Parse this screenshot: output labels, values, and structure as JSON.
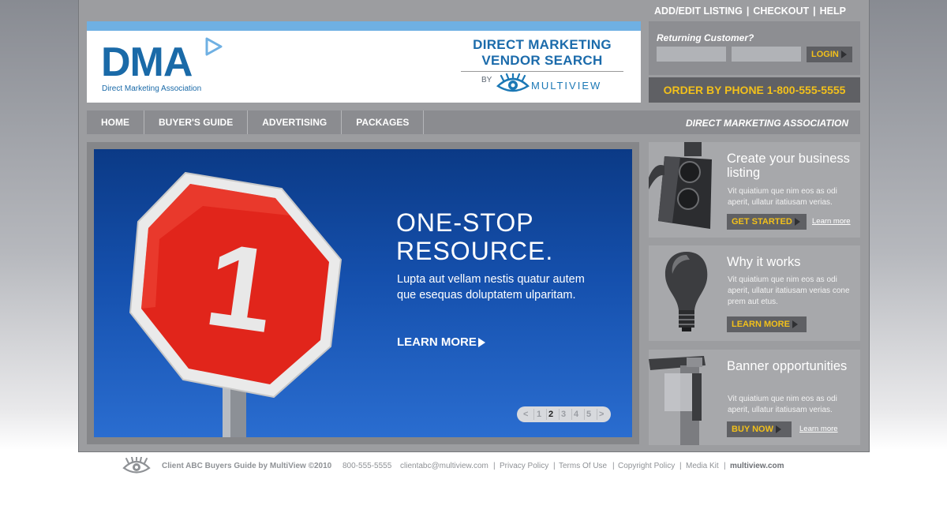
{
  "top_links": {
    "add_edit": "ADD/EDIT LISTING",
    "checkout": "CHECKOUT",
    "help": "HELP",
    "sep": "|"
  },
  "logo": {
    "mark": "DMA",
    "subtitle": "Direct Marketing Association",
    "title_line1": "DIRECT MARKETING",
    "title_line2": "VENDOR SEARCH",
    "by": "BY",
    "partner": "MULTIVIEW"
  },
  "login": {
    "heading": "Returning Customer?",
    "button": "LOGIN",
    "username_value": "",
    "password_value": ""
  },
  "order_by_phone": "ORDER BY PHONE 1-800-555-5555",
  "nav": {
    "items": [
      "HOME",
      "BUYER'S GUIDE",
      "ADVERTISING",
      "PACKAGES"
    ],
    "tagline": "DIRECT MARKETING ASSOCIATION"
  },
  "hero": {
    "sign_number": "1",
    "title_line1": "ONE-STOP",
    "title_line2": "RESOURCE.",
    "body": "Lupta aut vellam nestis quatur autem que esequas doluptatem ulparitam.",
    "cta": "LEARN MORE",
    "pager": {
      "prev": "<",
      "pages": [
        "1",
        "2",
        "3",
        "4",
        "5"
      ],
      "active": "2",
      "next": ">"
    }
  },
  "promos": [
    {
      "title": "Create your business listing",
      "body": "Vit quiatium que nim eos as odi aperit, ullatur itatiusam verias.",
      "button": "GET STARTED",
      "link": "Learn more",
      "art_icon": "traffic-light"
    },
    {
      "title": "Why it works",
      "body": "Vit quiatium que nim eos as odi aperit, ullatur itatiusam verias cone prem aut etus.",
      "button": "LEARN MORE",
      "link": "",
      "art_icon": "light-bulb"
    },
    {
      "title": "Banner opportunities",
      "body": "Vit quiatium que nim eos as odi aperit, ullatur itatiusam verias.",
      "button": "BUY NOW",
      "link": "Learn more",
      "art_icon": "banner-shapes"
    }
  ],
  "footer": {
    "credit": "Client ABC Buyers Guide by MultiView ©2010",
    "phone": "800-555-5555",
    "email": "clientabc@multiview.com",
    "links": [
      "Privacy Policy",
      "Terms Of Use",
      "Copyright Policy",
      "Media Kit"
    ],
    "site": "multiview.com",
    "sep": "|"
  },
  "colors": {
    "accent_yellow": "#f2c01b",
    "brand_blue": "#1a6aa8",
    "panel_gray": "#9c9da0",
    "hero_blue": "#1550ad"
  }
}
